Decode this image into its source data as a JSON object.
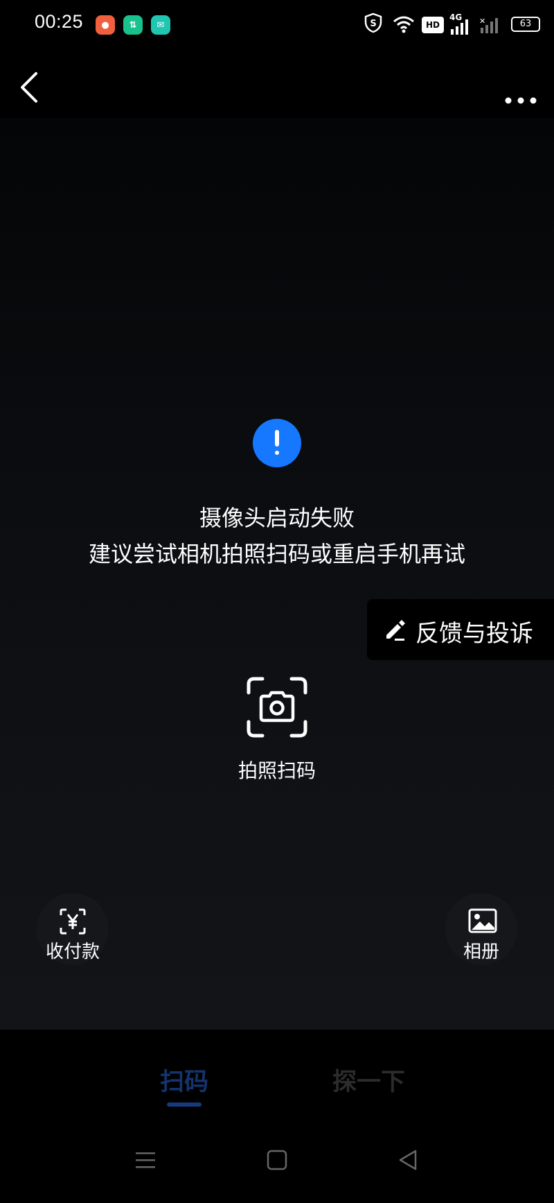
{
  "status_bar": {
    "time": "00:25",
    "hd_label": "HD",
    "network_label": "4G",
    "battery": "63"
  },
  "error": {
    "title": "摄像头启动失败",
    "subtitle": "建议尝试相机拍照扫码或重启手机再试"
  },
  "feedback": {
    "label": "反馈与投诉"
  },
  "photo_scan": {
    "label": "拍照扫码"
  },
  "corner_actions": {
    "payment_label": "收付款",
    "album_label": "相册"
  },
  "tabs": [
    {
      "label": "扫码",
      "active": true
    },
    {
      "label": "探一下",
      "active": false
    }
  ],
  "colors": {
    "accent": "#1677ff",
    "tab_active": "#13346e",
    "background": "#000000"
  },
  "icons": [
    "back-icon",
    "more-icon",
    "alert-icon",
    "pen-icon",
    "camera-scan-icon",
    "yuan-scan-icon",
    "image-icon",
    "menu-icon",
    "home-icon",
    "back-triangle-icon"
  ]
}
